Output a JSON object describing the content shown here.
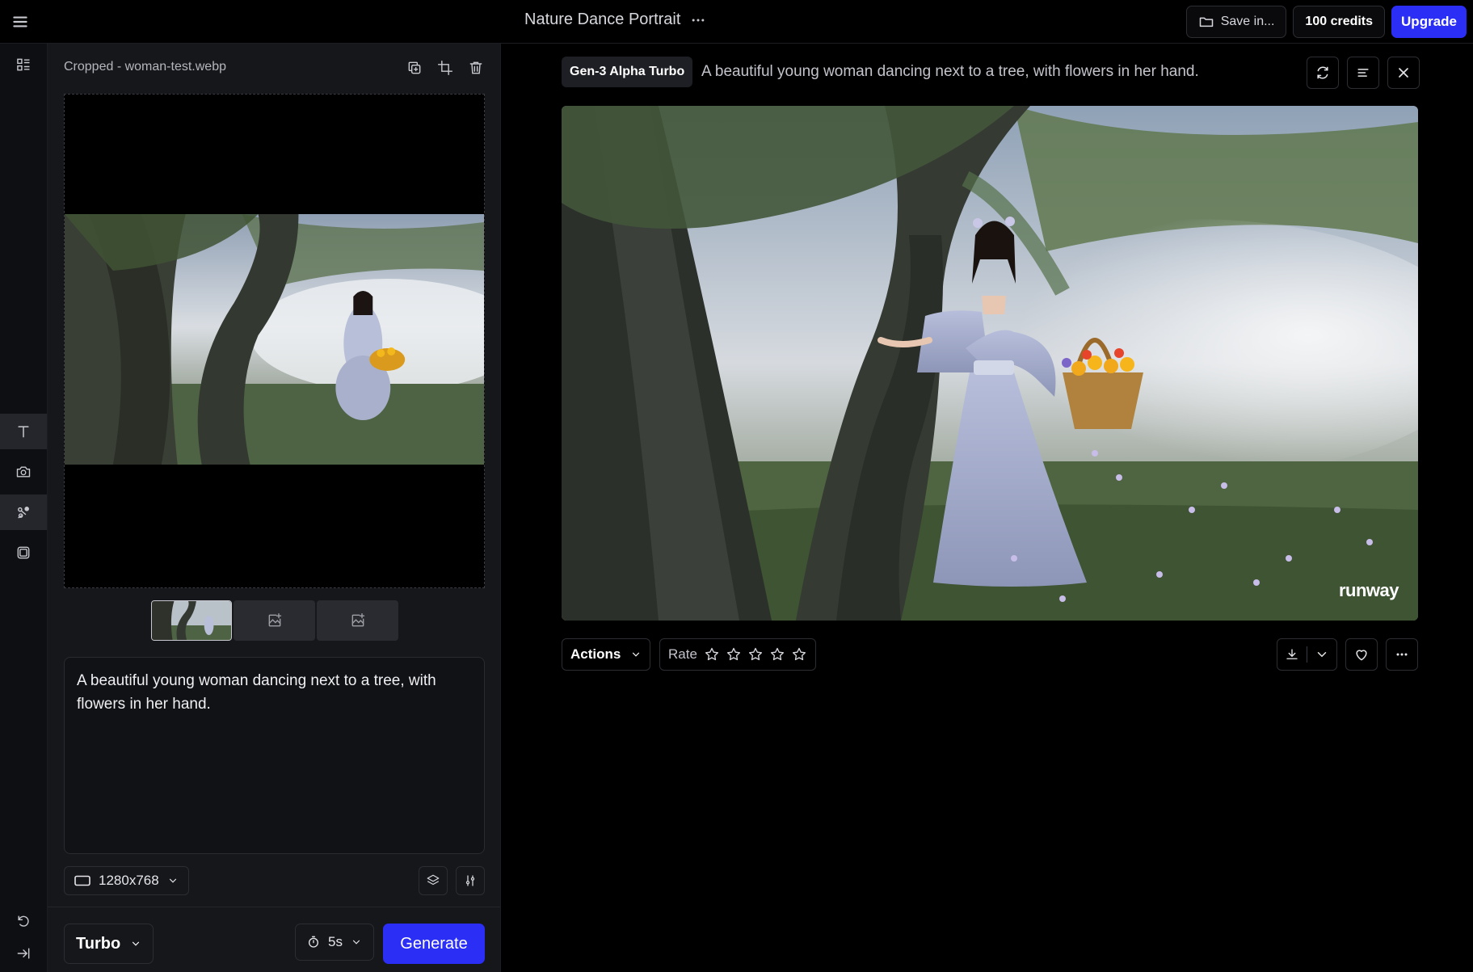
{
  "topbar": {
    "project_title": "Nature Dance Portrait",
    "save_label": "Save in...",
    "credits_label": "100 credits",
    "upgrade_label": "Upgrade"
  },
  "rail": {
    "items": [
      "tools-icon",
      "text-icon",
      "camera-icon",
      "motion-brush-icon",
      "frames-icon",
      "undo-icon",
      "collapse-icon"
    ]
  },
  "panel": {
    "file_label": "Cropped - woman-test.webp",
    "prompt_text": "A beautiful young woman dancing next to a tree, with flowers in her hand.",
    "resolution": "1280x768",
    "model": "Turbo",
    "duration": "5s",
    "generate_label": "Generate"
  },
  "main": {
    "model_badge": "Gen-3 Alpha Turbo",
    "prompt": "A beautiful young woman dancing next to a tree, with flowers in her hand.",
    "watermark": "runway",
    "actions_label": "Actions",
    "rate_label": "Rate",
    "rating_stars": 5
  },
  "colors": {
    "accent": "#2b2ef5",
    "background": "#000000",
    "panel": "#16171b"
  }
}
